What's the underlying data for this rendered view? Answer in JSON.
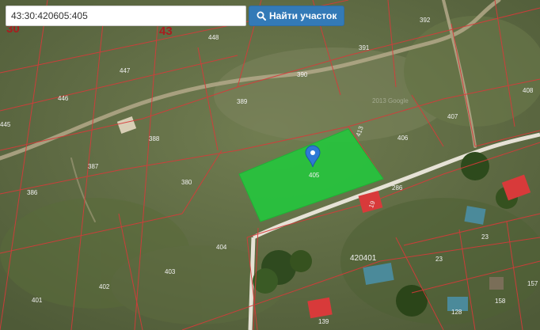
{
  "search": {
    "query": "43:30:420605:405",
    "button_label": "Найти участок",
    "button_icon": "search-icon"
  },
  "map": {
    "district_labels": [
      "30",
      "43"
    ],
    "block_label": "420401",
    "selected_parcel": "405",
    "watermark": "2013 Google",
    "parcel_numbers": [
      "448",
      "447",
      "446",
      "445",
      "389",
      "390",
      "391",
      "392",
      "388",
      "387",
      "386",
      "380",
      "404",
      "403",
      "402",
      "401",
      "406",
      "407",
      "408",
      "413",
      "286",
      "23",
      "158",
      "157",
      "139",
      "128",
      "19"
    ],
    "colors": {
      "selection": "#22c83c",
      "boundary": "#d83a3a",
      "button": "#337ab7",
      "marker": "#2f79d6"
    }
  }
}
